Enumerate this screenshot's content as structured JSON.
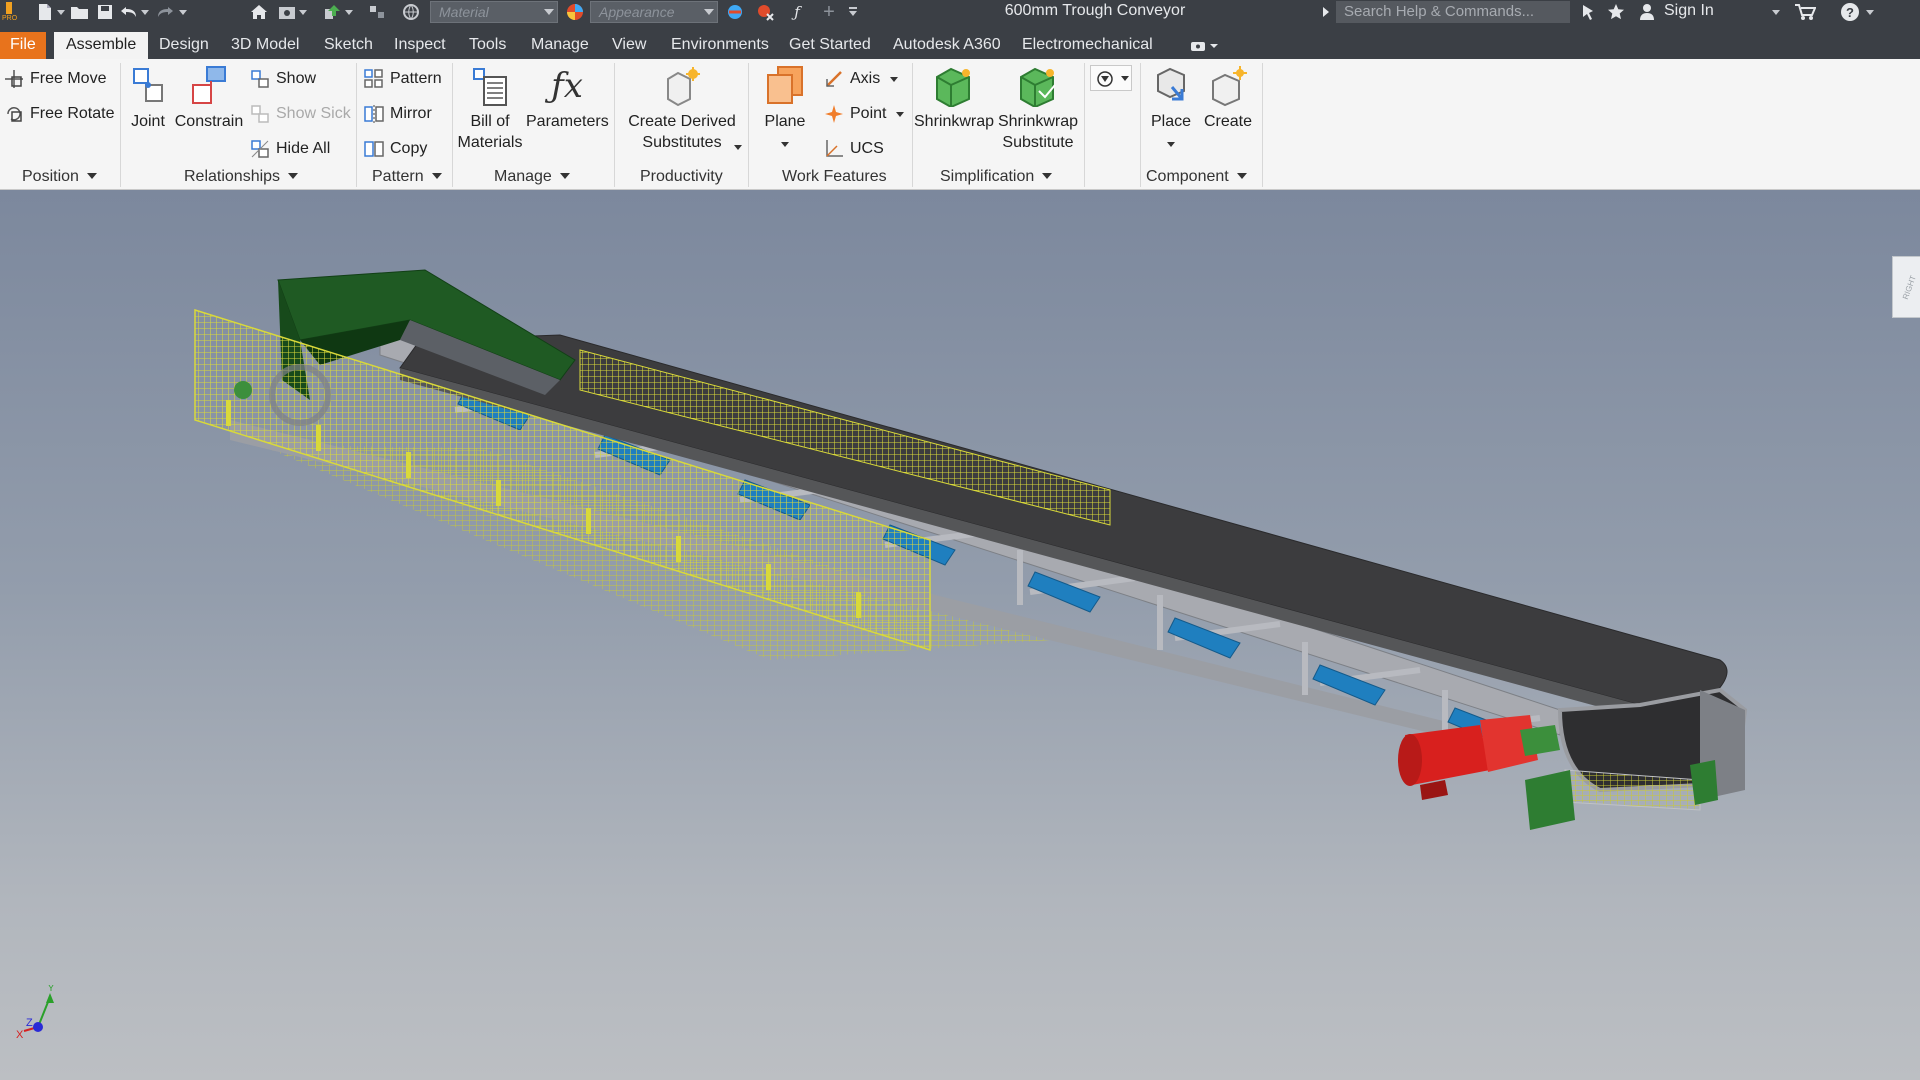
{
  "titlebar": {
    "material_placeholder": "Material",
    "appearance_placeholder": "Appearance",
    "document_title": "600mm Trough Conveyor",
    "search_placeholder": "Search Help & Commands...",
    "sign_in": "Sign In",
    "app_badge": "PRO"
  },
  "tabs": [
    "File",
    "Assemble",
    "Design",
    "3D Model",
    "Sketch",
    "Inspect",
    "Tools",
    "Manage",
    "View",
    "Environments",
    "Get Started",
    "Autodesk A360",
    "Electromechanical"
  ],
  "active_tab": "Assemble",
  "ribbon": {
    "position": {
      "label": "Position",
      "free_move": "Free Move",
      "free_rotate": "Free Rotate"
    },
    "relationships": {
      "label": "Relationships",
      "joint": "Joint",
      "constrain": "Constrain",
      "show": "Show",
      "show_sick": "Show Sick",
      "hide_all": "Hide All"
    },
    "pattern": {
      "label": "Pattern",
      "pattern": "Pattern",
      "mirror": "Mirror",
      "copy": "Copy"
    },
    "manage": {
      "label": "Manage",
      "bom_line1": "Bill of",
      "bom_line2": "Materials",
      "parameters": "Parameters"
    },
    "productivity": {
      "label": "Productivity",
      "cds_line1": "Create Derived",
      "cds_line2": "Substitutes"
    },
    "work_features": {
      "label": "Work Features",
      "plane": "Plane",
      "axis": "Axis",
      "point": "Point",
      "ucs": "UCS"
    },
    "simplification": {
      "label": "Simplification",
      "shrinkwrap": "Shrinkwrap",
      "sws_line1": "Shrinkwrap",
      "sws_line2": "Substitute"
    },
    "component": {
      "label": "Component",
      "place": "Place",
      "create": "Create"
    }
  },
  "viewcube_label": "RIGHT",
  "triad": {
    "x": "X",
    "y": "Y",
    "z": "Z"
  },
  "colors": {
    "file_tab": "#e8731c",
    "belt": "#3c3c3e",
    "frame": "#a8aab0",
    "roller": "#1f7fbf",
    "guard_mesh": "#d9d93a",
    "hopper": "#1f5a23",
    "motor": "#d8201e"
  }
}
